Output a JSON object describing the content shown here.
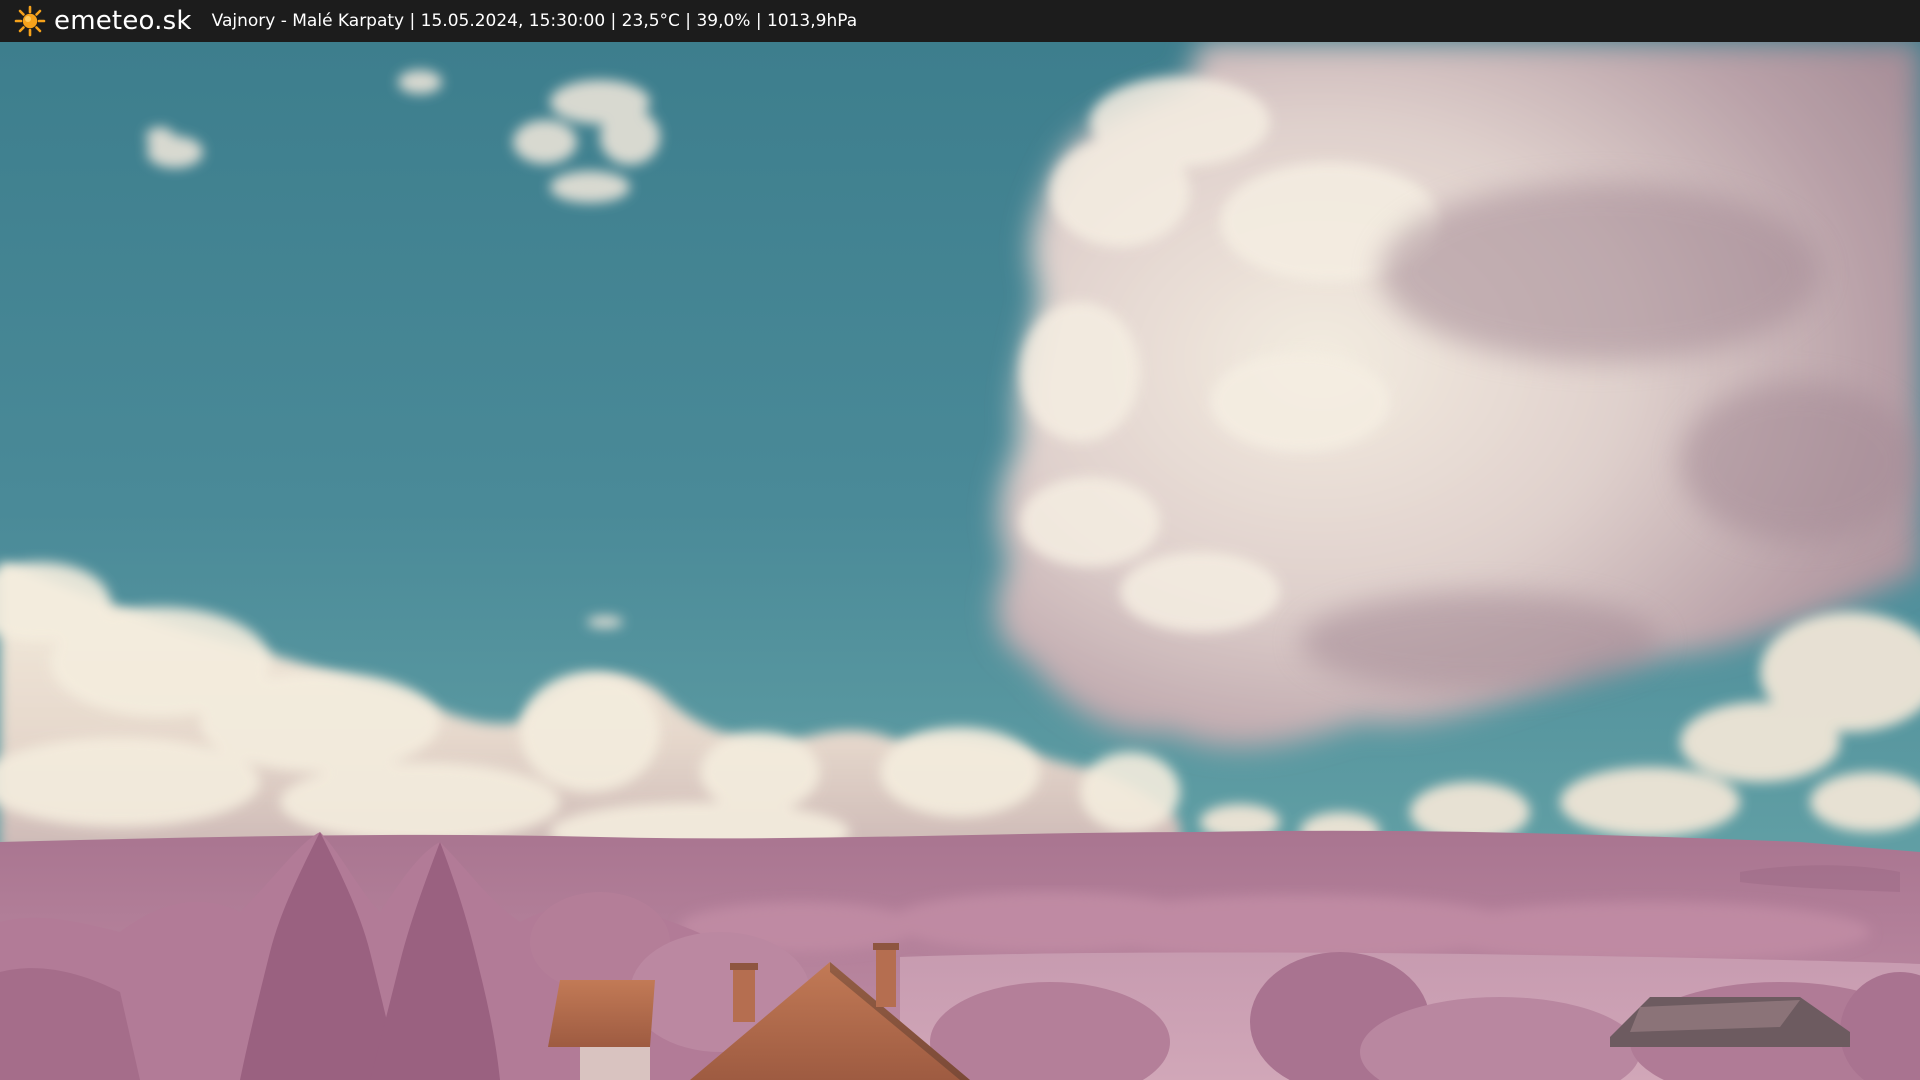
{
  "header": {
    "brand": "emeteo.sk",
    "logo_icon": "sun-icon",
    "stats": "Vajnory - Malé Karpaty | 15.05.2024, 15:30:00 | 23,5°C | 39,0% | 1013,9hPa"
  },
  "colors": {
    "bar_background": "#1c1c1c",
    "bar_text": "#ffffff",
    "sun": "#f6a21b",
    "sky_top": "#3f8190",
    "sky_horizon": "#6aa1a3",
    "cloud_light": "#f1ead9",
    "cloud_shadow": "#b39aa3",
    "foliage": "#b77f9a",
    "foliage_dark": "#8a5570",
    "roof": "#b96a4b"
  }
}
